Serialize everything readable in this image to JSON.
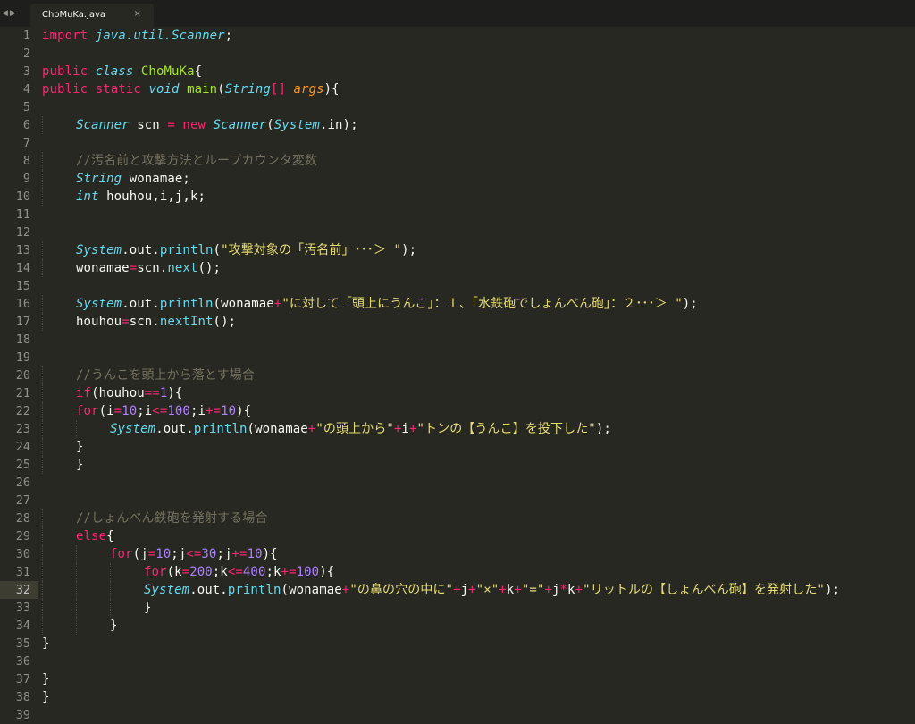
{
  "tab": {
    "filename": "ChoMuKa.java",
    "close_glyph": "×"
  },
  "nav": {
    "back": "◀",
    "forward": "▶"
  },
  "current_line": 32,
  "colors": {
    "background": "#272822",
    "keyword": "#f92672",
    "type": "#66d9ef",
    "class_name": "#a6e22e",
    "string": "#e6db74",
    "number": "#ae81ff",
    "comment": "#75715e",
    "parameter": "#fd971f",
    "text": "#f8f8f2"
  },
  "lines": [
    {
      "n": "1",
      "indent": 0,
      "tokens": [
        [
          "kw",
          "import"
        ],
        [
          "pl",
          " "
        ],
        [
          "ty",
          "java.util.Scanner"
        ],
        [
          "pl",
          ";"
        ]
      ]
    },
    {
      "n": "2",
      "indent": 0,
      "tokens": []
    },
    {
      "n": "3",
      "indent": 0,
      "tokens": [
        [
          "kw",
          "public"
        ],
        [
          "pl",
          " "
        ],
        [
          "ty",
          "class"
        ],
        [
          "pl",
          " "
        ],
        [
          "cl",
          "ChoMuKa"
        ],
        [
          "pl",
          "{"
        ]
      ]
    },
    {
      "n": "4",
      "indent": 0,
      "tokens": [
        [
          "kw",
          "public"
        ],
        [
          "pl",
          " "
        ],
        [
          "kw",
          "static"
        ],
        [
          "pl",
          " "
        ],
        [
          "ty",
          "void"
        ],
        [
          "pl",
          " "
        ],
        [
          "cl",
          "main"
        ],
        [
          "pl",
          "("
        ],
        [
          "ty",
          "String"
        ],
        [
          "kw",
          "[]"
        ],
        [
          "pl",
          " "
        ],
        [
          "prm",
          "args"
        ],
        [
          "pl",
          "){"
        ]
      ]
    },
    {
      "n": "5",
      "indent": 0,
      "tokens": []
    },
    {
      "n": "6",
      "indent": 1,
      "tokens": [
        [
          "ty",
          "Scanner"
        ],
        [
          "pl",
          " scn "
        ],
        [
          "kw",
          "="
        ],
        [
          "pl",
          " "
        ],
        [
          "kw",
          "new"
        ],
        [
          "pl",
          " "
        ],
        [
          "ty",
          "Scanner"
        ],
        [
          "pl",
          "("
        ],
        [
          "ty",
          "System"
        ],
        [
          "pl",
          ".in);"
        ]
      ]
    },
    {
      "n": "7",
      "indent": 1,
      "tokens": []
    },
    {
      "n": "8",
      "indent": 1,
      "tokens": [
        [
          "cm",
          "//汚名前と攻撃方法とループカウンタ変数"
        ]
      ]
    },
    {
      "n": "9",
      "indent": 1,
      "tokens": [
        [
          "ty",
          "String"
        ],
        [
          "pl",
          " wonamae;"
        ]
      ]
    },
    {
      "n": "10",
      "indent": 1,
      "tokens": [
        [
          "ty",
          "int"
        ],
        [
          "pl",
          " houhou,i,j,k;"
        ]
      ]
    },
    {
      "n": "11",
      "indent": 1,
      "tokens": []
    },
    {
      "n": "12",
      "indent": 1,
      "tokens": []
    },
    {
      "n": "13",
      "indent": 1,
      "tokens": [
        [
          "ty",
          "System"
        ],
        [
          "pl",
          ".out."
        ],
        [
          "fn",
          "println"
        ],
        [
          "pl",
          "("
        ],
        [
          "str",
          "\"攻撃対象の「汚名前」･･･＞ \""
        ],
        [
          "pl",
          ");"
        ]
      ]
    },
    {
      "n": "14",
      "indent": 1,
      "tokens": [
        [
          "pl",
          "wonamae"
        ],
        [
          "kw",
          "="
        ],
        [
          "pl",
          "scn."
        ],
        [
          "fn",
          "next"
        ],
        [
          "pl",
          "();"
        ]
      ]
    },
    {
      "n": "15",
      "indent": 1,
      "tokens": []
    },
    {
      "n": "16",
      "indent": 1,
      "tokens": [
        [
          "ty",
          "System"
        ],
        [
          "pl",
          ".out."
        ],
        [
          "fn",
          "println"
        ],
        [
          "pl",
          "(wonamae"
        ],
        [
          "kw",
          "+"
        ],
        [
          "str",
          "\"に対して「頭上にうんこ」：１、「水鉄砲でしょんべん砲」：２･･･＞ \""
        ],
        [
          "pl",
          ");"
        ]
      ]
    },
    {
      "n": "17",
      "indent": 1,
      "tokens": [
        [
          "pl",
          "houhou"
        ],
        [
          "kw",
          "="
        ],
        [
          "pl",
          "scn."
        ],
        [
          "fn",
          "nextInt"
        ],
        [
          "pl",
          "();"
        ]
      ]
    },
    {
      "n": "18",
      "indent": 1,
      "tokens": []
    },
    {
      "n": "19",
      "indent": 1,
      "tokens": []
    },
    {
      "n": "20",
      "indent": 1,
      "tokens": [
        [
          "cm",
          "//うんこを頭上から落とす場合"
        ]
      ]
    },
    {
      "n": "21",
      "indent": 1,
      "tokens": [
        [
          "kw",
          "if"
        ],
        [
          "pl",
          "(houhou"
        ],
        [
          "kw",
          "=="
        ],
        [
          "num",
          "1"
        ],
        [
          "pl",
          "){"
        ]
      ]
    },
    {
      "n": "22",
      "indent": 1,
      "tokens": [
        [
          "kw",
          "for"
        ],
        [
          "pl",
          "(i"
        ],
        [
          "kw",
          "="
        ],
        [
          "num",
          "10"
        ],
        [
          "pl",
          ";i"
        ],
        [
          "kw",
          "<="
        ],
        [
          "num",
          "100"
        ],
        [
          "pl",
          ";i"
        ],
        [
          "kw",
          "+="
        ],
        [
          "num",
          "10"
        ],
        [
          "pl",
          "){"
        ]
      ]
    },
    {
      "n": "23",
      "indent": 2,
      "tokens": [
        [
          "ty",
          "System"
        ],
        [
          "pl",
          ".out."
        ],
        [
          "fn",
          "println"
        ],
        [
          "pl",
          "(wonamae"
        ],
        [
          "kw",
          "+"
        ],
        [
          "str",
          "\"の頭上から\""
        ],
        [
          "kw",
          "+"
        ],
        [
          "pl",
          "i"
        ],
        [
          "kw",
          "+"
        ],
        [
          "str",
          "\"トンの【うんこ】を投下した\""
        ],
        [
          "pl",
          ");"
        ]
      ]
    },
    {
      "n": "24",
      "indent": 1,
      "tokens": [
        [
          "pl",
          "}"
        ]
      ]
    },
    {
      "n": "25",
      "indent": 1,
      "tokens": [
        [
          "pl",
          "}"
        ]
      ]
    },
    {
      "n": "26",
      "indent": 1,
      "tokens": []
    },
    {
      "n": "27",
      "indent": 1,
      "tokens": []
    },
    {
      "n": "28",
      "indent": 1,
      "tokens": [
        [
          "cm",
          "//しょんべん鉄砲を発射する場合"
        ]
      ]
    },
    {
      "n": "29",
      "indent": 1,
      "tokens": [
        [
          "kw",
          "else"
        ],
        [
          "pl",
          "{"
        ]
      ]
    },
    {
      "n": "30",
      "indent": 2,
      "tokens": [
        [
          "kw",
          "for"
        ],
        [
          "pl",
          "(j"
        ],
        [
          "kw",
          "="
        ],
        [
          "num",
          "10"
        ],
        [
          "pl",
          ";j"
        ],
        [
          "kw",
          "<="
        ],
        [
          "num",
          "30"
        ],
        [
          "pl",
          ";j"
        ],
        [
          "kw",
          "+="
        ],
        [
          "num",
          "10"
        ],
        [
          "pl",
          "){"
        ]
      ]
    },
    {
      "n": "31",
      "indent": 3,
      "tokens": [
        [
          "kw",
          "for"
        ],
        [
          "pl",
          "(k"
        ],
        [
          "kw",
          "="
        ],
        [
          "num",
          "200"
        ],
        [
          "pl",
          ";k"
        ],
        [
          "kw",
          "<="
        ],
        [
          "num",
          "400"
        ],
        [
          "pl",
          ";k"
        ],
        [
          "kw",
          "+="
        ],
        [
          "num",
          "100"
        ],
        [
          "pl",
          "){"
        ]
      ]
    },
    {
      "n": "32",
      "indent": 3,
      "tokens": [
        [
          "ty",
          "System"
        ],
        [
          "pl",
          ".out."
        ],
        [
          "fn",
          "println"
        ],
        [
          "pl",
          "(wonamae"
        ],
        [
          "kw",
          "+"
        ],
        [
          "str",
          "\"の鼻の穴の中に\""
        ],
        [
          "kw",
          "+"
        ],
        [
          "pl",
          "j"
        ],
        [
          "kw",
          "+"
        ],
        [
          "str",
          "\"×\""
        ],
        [
          "kw",
          "+"
        ],
        [
          "pl",
          "k"
        ],
        [
          "kw",
          "+"
        ],
        [
          "str",
          "\"=\""
        ],
        [
          "kw",
          "+"
        ],
        [
          "pl",
          "j"
        ],
        [
          "kw",
          "*"
        ],
        [
          "pl",
          "k"
        ],
        [
          "kw",
          "+"
        ],
        [
          "str",
          "\"リットルの【しょんべん砲】を発射した\""
        ],
        [
          "pl",
          ");"
        ]
      ]
    },
    {
      "n": "33",
      "indent": 3,
      "tokens": [
        [
          "pl",
          "}"
        ]
      ]
    },
    {
      "n": "34",
      "indent": 2,
      "tokens": [
        [
          "pl",
          "}"
        ]
      ]
    },
    {
      "n": "35",
      "indent": 0,
      "tokens": [
        [
          "pl",
          "}"
        ]
      ]
    },
    {
      "n": "36",
      "indent": 0,
      "tokens": []
    },
    {
      "n": "37",
      "indent": 0,
      "tokens": [
        [
          "pl",
          "}"
        ]
      ]
    },
    {
      "n": "38",
      "indent": 0,
      "tokens": [
        [
          "pl",
          "}"
        ]
      ]
    },
    {
      "n": "39",
      "indent": 0,
      "tokens": []
    }
  ]
}
